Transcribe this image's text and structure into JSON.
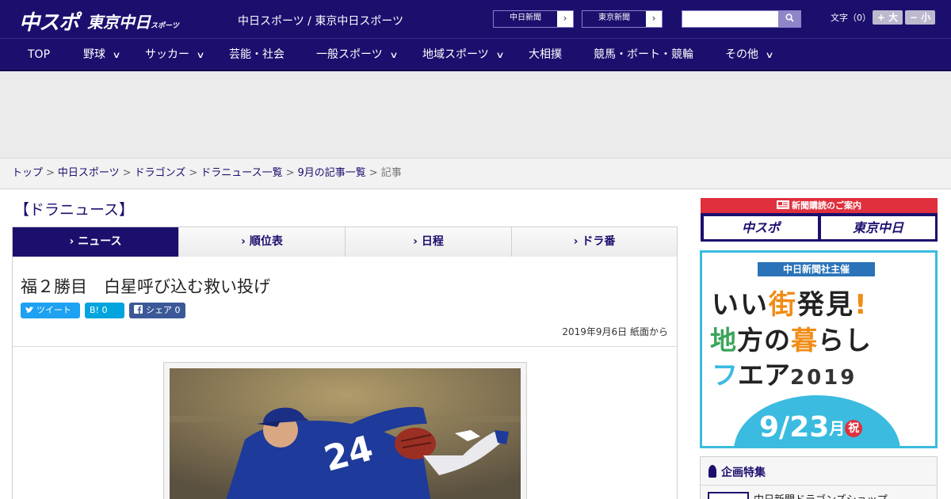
{
  "header": {
    "logo_main": "中スポ",
    "logo_tokyo": "東京中日",
    "logo_tokyo_sub": "スポーツ",
    "site_title": "中日スポーツ / 東京中日スポーツ",
    "btn_chunichi": "中日新聞",
    "btn_tokyo": "東京新聞",
    "search_placeholder": "",
    "font_label": "文字（0）",
    "font_bigger": "+ 大",
    "font_smaller": "− 小"
  },
  "nav": {
    "items": [
      {
        "label": "TOP"
      },
      {
        "label": "野球"
      },
      {
        "label": "サッカー"
      },
      {
        "label": "芸能・社会"
      },
      {
        "label": "一般スポーツ"
      },
      {
        "label": "地域スポーツ"
      },
      {
        "label": "大相撲"
      },
      {
        "label": "競馬・ボート・競輪"
      },
      {
        "label": "その他"
      }
    ]
  },
  "breadcrumb": {
    "items": [
      "トップ",
      "中日スポーツ",
      "ドラゴンズ",
      "ドラニュース一覧",
      "9月の記事一覧"
    ],
    "current": "記事"
  },
  "section": {
    "title": "【ドラニュース】"
  },
  "tabs": [
    {
      "label": "ニュース"
    },
    {
      "label": "順位表"
    },
    {
      "label": "日程"
    },
    {
      "label": "ドラ番"
    }
  ],
  "article": {
    "headline": "福２勝目　白星呼び込む救い投げ",
    "share_tweet": "ツイート",
    "share_hatena": "B! 0",
    "share_fb": "シェア 0",
    "date": "2019年9月6日 紙面から"
  },
  "sidebar": {
    "subscribe_head": "新聞購読のご案内",
    "subscribe_chuspo": "中スポ",
    "subscribe_tokyo": "東京中日",
    "fair_badge": "中日新聞社主催",
    "fair_line1a": "いい",
    "fair_line1b": "街",
    "fair_line1c": "発見",
    "fair_line1d": "!",
    "fair_line2a": "地",
    "fair_line2b": "方の",
    "fair_line2c": "暮",
    "fair_line2d": "らし",
    "fair_line3a": "フ",
    "fair_line3b": "エア",
    "fair_line3c": "2019",
    "fair_date": "9/23",
    "fair_month": "月",
    "fair_holiday": "祝",
    "feature_title": "企画特集",
    "feature_item": "中日新聞ドラゴンズショップ"
  }
}
